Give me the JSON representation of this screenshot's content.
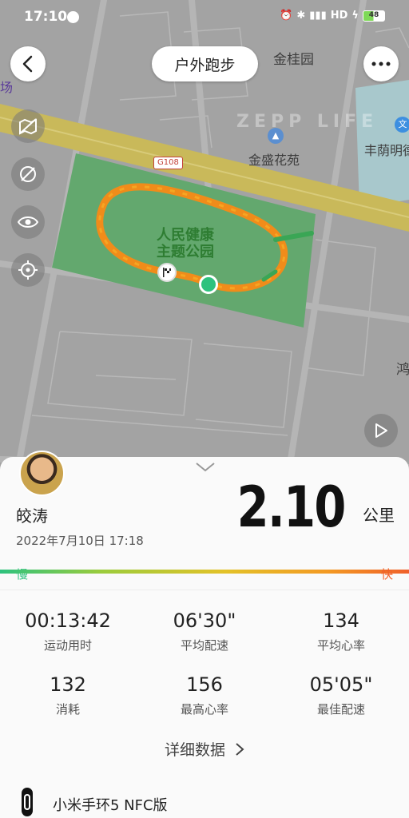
{
  "status_bar": {
    "time": "17:10",
    "network": "HD",
    "battery": "48"
  },
  "header": {
    "title": "户外跑步"
  },
  "map": {
    "labels": {
      "jingui": "金桂园",
      "jinsheng": "金盛花苑",
      "fengming": "丰荫明德",
      "chang": "场",
      "hong": "鸿",
      "park_line1": "人民健康",
      "park_line2": "主题公园",
      "road_shield": "G108",
      "watermark": "ZEPP LIFE"
    }
  },
  "summary": {
    "username": "皎涛",
    "datetime": "2022年7月10日 17:18",
    "distance": "2.10",
    "unit": "公里",
    "pace_slow": "慢",
    "pace_fast": "快"
  },
  "stats": [
    {
      "value": "00:13:42",
      "label": "运动用时"
    },
    {
      "value": "06'30\"",
      "label": "平均配速"
    },
    {
      "value": "134",
      "label": "平均心率"
    },
    {
      "value": "132",
      "label": "消耗"
    },
    {
      "value": "156",
      "label": "最高心率"
    },
    {
      "value": "05'05\"",
      "label": "最佳配速"
    }
  ],
  "details_link": "详细数据",
  "device": {
    "name": "小米手环5 NFC版"
  }
}
